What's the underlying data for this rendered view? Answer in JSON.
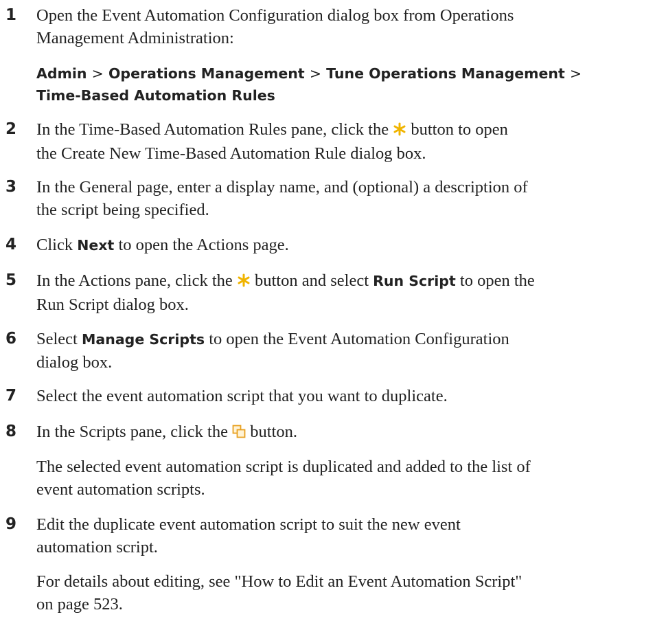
{
  "steps": [
    {
      "num": "1",
      "line1": "Open the Event Automation Configuration dialog box from Operations",
      "line2": "Management Administration:",
      "path": {
        "admin": "Admin",
        "ops": "Operations Management",
        "tune": "Tune Operations Management",
        "rules": "Time-Based Automation Rules",
        "sep": ">"
      }
    },
    {
      "num": "2",
      "pre": "In the Time-Based Automation Rules pane, click the",
      "post": "button to open",
      "line2": "the Create New Time-Based Automation Rule dialog box."
    },
    {
      "num": "3",
      "line1": "In the General page, enter a display name, and (optional) a description of",
      "line2": "the script being specified."
    },
    {
      "num": "4",
      "pre": "Click",
      "bold": "Next",
      "post": "to open the Actions page."
    },
    {
      "num": "5",
      "pre": "In the Actions pane, click the",
      "mid": "button and select",
      "bold": "Run Script",
      "post": "to open the",
      "line2": "Run Script dialog box."
    },
    {
      "num": "6",
      "pre": "Select",
      "bold": "Manage Scripts",
      "post": "to open the Event Automation Configuration",
      "line2": "dialog box."
    },
    {
      "num": "7",
      "line1": "Select the event automation script that you want to duplicate."
    },
    {
      "num": "8",
      "pre": "In the Scripts pane, click the",
      "post": "button.",
      "note_line1": "The selected event automation script is duplicated and added to the list of",
      "note_line2": "event automation scripts."
    },
    {
      "num": "9",
      "line1": "Edit the duplicate event automation script to suit the new event",
      "line2": "automation script.",
      "note_line1": "For details about editing, see \"How to Edit an Event Automation Script\"",
      "note_line2": "on page 523."
    }
  ],
  "icons": {
    "new_icon": "asterisk-star-icon",
    "duplicate_icon": "duplicate-icon",
    "new_color": "#f0b400",
    "duplicate_color": "#e8a020"
  }
}
